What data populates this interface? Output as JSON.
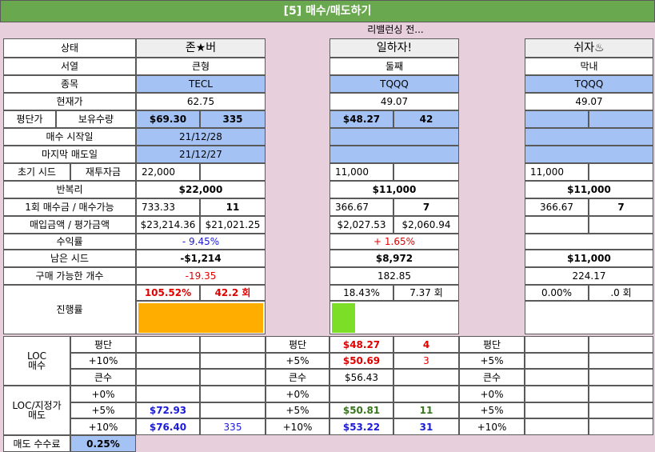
{
  "title": "[5] 매수/매도하기",
  "status_note": "리밸런싱 전...",
  "labels": {
    "state": "상태",
    "order": "서열",
    "ticker": "종목",
    "price": "현재가",
    "avg": "평단가",
    "qty": "보유수량",
    "start": "매수 시작일",
    "last": "마지막 매도일",
    "seed": "초기 시드",
    "reinvest": "재투자금",
    "compound": "반복리",
    "perbuy": "1회 매수금 / 매수가능",
    "amounts": "매입금액 / 평가금액",
    "yield": "수익률",
    "remain": "남은 시드",
    "buyable": "구매 가능한 개수",
    "progress": "진행률",
    "loc_buy": "LOC\n매수",
    "avg_short": "평단",
    "plus10": "+10%",
    "plus5": "+5%",
    "plus0": "+0%",
    "big": "큰수",
    "loc_sell": "LOC/지정가\n매도",
    "fee": "매도 수수료",
    "fee_val": "0.25%"
  },
  "accounts": [
    {
      "name": "존★버",
      "order": "큰형",
      "ticker": "TECL",
      "price": "62.75",
      "avg": "$69.30",
      "qty": "335",
      "start": "21/12/28",
      "last": "21/12/27",
      "seed": "22,000",
      "compound": "$22,000",
      "perbuy": "733.33",
      "perbuy_cnt": "11",
      "buy_amt": "$23,214.36",
      "eval_amt": "$21,021.25",
      "yield": "- 9.45%",
      "remain": "-$1,214",
      "buyable": "-19.35",
      "prog_pct": "105.52%",
      "prog_cnt": "42.2 회",
      "progress": 1.0,
      "loc_avg": "",
      "loc_avg_qty": "",
      "loc_10": "",
      "loc_10_qty": "",
      "loc_big": "",
      "sell_0": "",
      "sell_0_qty": "",
      "sell_5": "$72.93",
      "sell_5_qty": "",
      "sell_10": "$76.40",
      "sell_10_qty": "335"
    },
    {
      "name": "일하자!",
      "order": "둘째",
      "ticker": "TQQQ",
      "price": "49.07",
      "avg": "$48.27",
      "qty": "42",
      "start": "",
      "last": "",
      "seed": "11,000",
      "compound": "$11,000",
      "perbuy": "366.67",
      "perbuy_cnt": "7",
      "buy_amt": "$2,027.53",
      "eval_amt": "$2,060.94",
      "yield": "+ 1.65%",
      "remain": "$8,972",
      "buyable": "182.85",
      "prog_pct": "18.43%",
      "prog_cnt": "7.37 회",
      "progress": 0.1843,
      "loc_avg_label": "평단",
      "loc_10_label": "+5%",
      "loc_big_label": "큰수",
      "loc_avg": "$48.27",
      "loc_avg_qty": "4",
      "loc_10": "$50.69",
      "loc_10_qty": "3",
      "loc_big": "$56.43",
      "sell_0_label": "+0%",
      "sell_5_label": "+5%",
      "sell_10_label": "+10%",
      "sell_0": "",
      "sell_0_qty": "",
      "sell_5": "$50.81",
      "sell_5_qty": "11",
      "sell_10": "$53.22",
      "sell_10_qty": "31"
    },
    {
      "name": "쉬자♨",
      "order": "막내",
      "ticker": "TQQQ",
      "price": "49.07",
      "avg": "",
      "qty": "",
      "start": "",
      "last": "",
      "seed": "11,000",
      "compound": "$11,000",
      "perbuy": "366.67",
      "perbuy_cnt": "7",
      "buy_amt": "",
      "eval_amt": "",
      "yield": "",
      "remain": "$11,000",
      "buyable": "224.17",
      "prog_pct": "0.00%",
      "prog_cnt": ".0 회",
      "progress": 0.0,
      "loc_avg_label": "평단",
      "loc_10_label": "+5%",
      "loc_big_label": "큰수",
      "sell_0_label": "+0%",
      "sell_5_label": "+5%",
      "sell_10_label": "+10%"
    }
  ],
  "colors": {
    "title_bg": "#6aa84f",
    "pink_bg": "#e7cfdb",
    "blue_cell": "#a4c2f4",
    "progress_orange": "#ffae00",
    "progress_green": "#7cde27"
  }
}
